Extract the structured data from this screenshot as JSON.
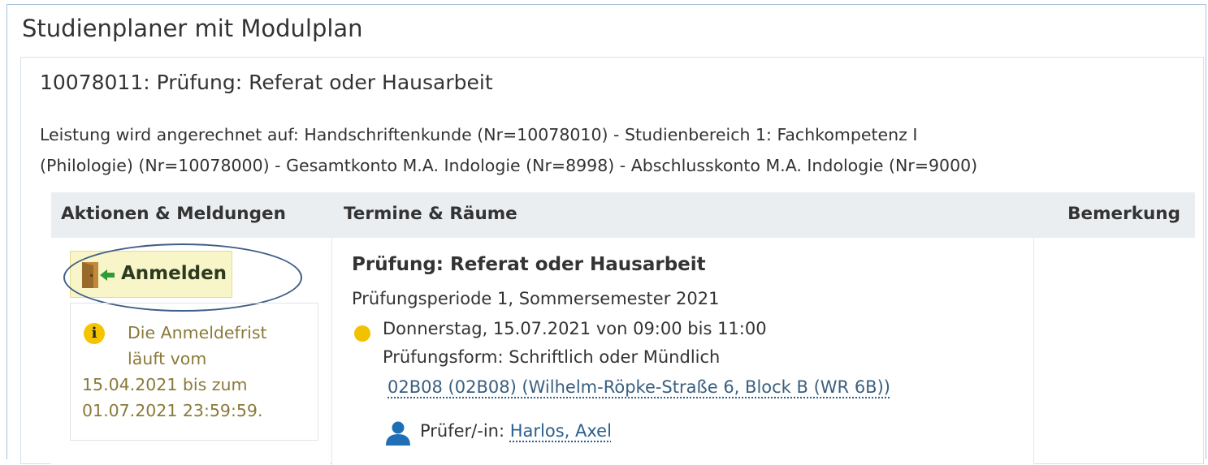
{
  "page": {
    "title": "Studienplaner mit Modulplan"
  },
  "exam": {
    "title": "10078011: Prüfung: Referat oder Hausarbeit",
    "credited_line1": "Leistung wird angerechnet auf: Handschriftenkunde (Nr=10078010) - Studienbereich 1: Fachkompetenz I",
    "credited_line2": "(Philologie) (Nr=10078000) - Gesamtkonto M.A. Indologie (Nr=8998) - Abschlusskonto M.A. Indologie (Nr=9000)"
  },
  "table": {
    "headers": {
      "actions": "Aktionen & Meldungen",
      "dates": "Termine & Räume",
      "remark": "Bemerkung"
    }
  },
  "actions": {
    "register_label": "Anmelden",
    "register_icon": "door-enter-icon",
    "info_lines": [
      "Die Anmeldefrist",
      "läuft vom",
      "15.04.2021 bis zum",
      "01.07.2021 23:59:59."
    ]
  },
  "dates": {
    "title": "Prüfung: Referat oder Hausarbeit",
    "period": "Prüfungsperiode 1, Sommersemester 2021",
    "date": "Donnerstag, 15.07.2021 von 09:00 bis 11:00",
    "form": "Prüfungsform: Schriftlich oder Mündlich",
    "room": "02B08 (02B08) (Wilhelm-Röpke-Straße 6, Block B (WR 6B))",
    "examiner_label": "Prüfer/-in:",
    "examiner_name": "Harlos, Axel"
  },
  "colors": {
    "accent": "#2b5f8f",
    "highlight": "#f8f5c8",
    "status_dot": "#f2c200",
    "annotation": "#3f5e86"
  }
}
